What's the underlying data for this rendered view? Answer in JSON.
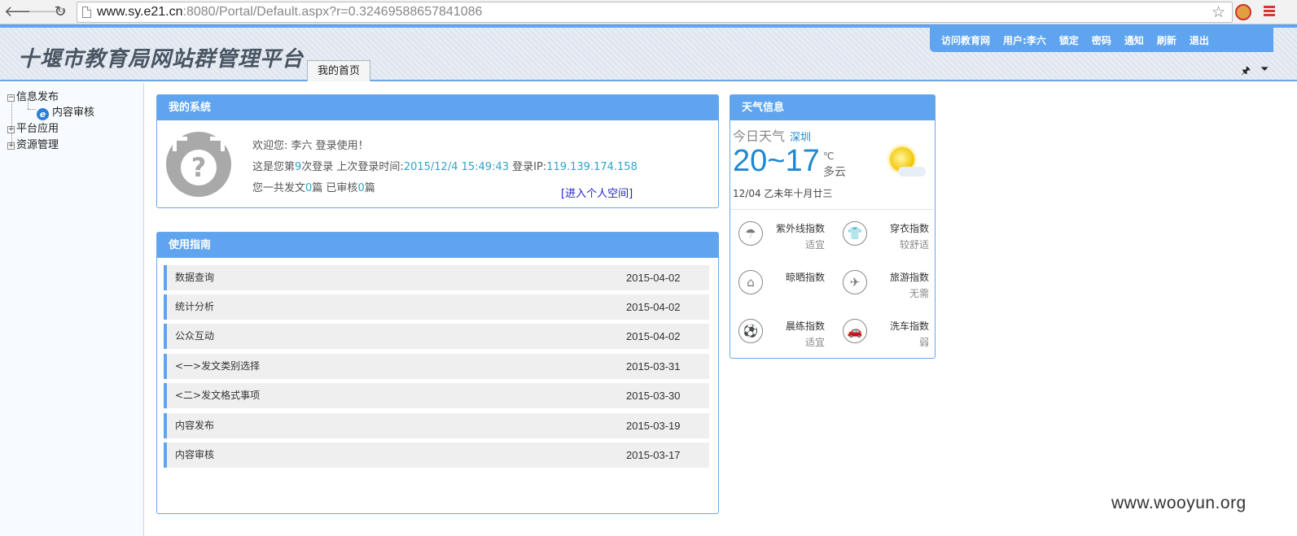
{
  "browser": {
    "url_host": "www.sy.e21.cn",
    "url_rest": ":8080/Portal/Default.aspx?r=0.32469588657841086",
    "back_glyph": "🡐",
    "forward_glyph": "🡒",
    "reload_glyph": "↻",
    "star_glyph": "☆"
  },
  "header": {
    "site_title": "十堰市教育局网站群管理平台",
    "home_tab": "我的首页",
    "nav": [
      "访问教育网",
      "用户:李六",
      "锁定",
      "密码",
      "通知",
      "刷新",
      "退出"
    ],
    "pin_glyph": "🖈",
    "down_glyph": "⏷"
  },
  "sidebar": {
    "nodes": [
      {
        "label": "信息发布",
        "toggle": "−"
      },
      {
        "label": "内容审核",
        "toggle": ""
      },
      {
        "label": "平台应用",
        "toggle": "+"
      },
      {
        "label": "资源管理",
        "toggle": "+"
      }
    ],
    "ie_glyph": "e"
  },
  "my_system": {
    "title": "我的系统",
    "avatar_glyph": "?",
    "welcome_prefix": "欢迎您: 李六  登录使用！",
    "login_prefix": "这是您第",
    "login_count": "9",
    "login_mid": "次登录 上次登录时间:",
    "last_login_time": "2015/12/4 15:49:43",
    "ip_label": " 登录IP:",
    "ip": "119.139.174.158",
    "posts_prefix": "您一共发文",
    "posts_count": "0",
    "posts_mid": "篇  已审核",
    "reviewed_count": "0",
    "posts_suffix": "篇",
    "space_link": "[进入个人空间]"
  },
  "guide": {
    "title": "使用指南",
    "rows": [
      {
        "title": "数据查询",
        "date": "2015-04-02"
      },
      {
        "title": "统计分析",
        "date": "2015-04-02"
      },
      {
        "title": "公众互动",
        "date": "2015-04-02"
      },
      {
        "title": "<一>发文类别选择",
        "date": "2015-03-31"
      },
      {
        "title": "<二>发文格式事项",
        "date": "2015-03-30"
      },
      {
        "title": "内容发布",
        "date": "2015-03-19"
      },
      {
        "title": "内容审核",
        "date": "2015-03-17"
      }
    ]
  },
  "weather": {
    "title": "天气信息",
    "today_label": "今日天气",
    "city": "深圳",
    "temp": "20~17",
    "unit": "℃",
    "condition": "多云",
    "date": "12/04 乙未年十月廿三",
    "indices": [
      {
        "name": "紫外线指数",
        "value": "适宜",
        "glyph": "☂"
      },
      {
        "name": "穿衣指数",
        "value": "较舒适",
        "glyph": "👕"
      },
      {
        "name": "晾晒指数",
        "value": "",
        "glyph": "⌂"
      },
      {
        "name": "旅游指数",
        "value": "无需",
        "glyph": "✈"
      },
      {
        "name": "晨练指数",
        "value": "适宜",
        "glyph": "⚽"
      },
      {
        "name": "洗车指数",
        "value": "弱",
        "glyph": "🚗"
      }
    ]
  },
  "watermark": "www.wooyun.org"
}
